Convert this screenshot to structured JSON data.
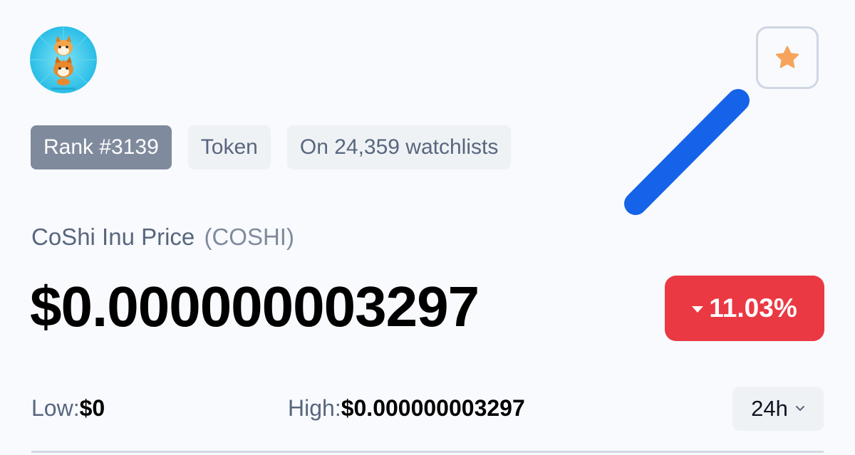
{
  "coin": {
    "logo_icon": "shiba-inu-logo-icon",
    "favorite_icon": "star-icon"
  },
  "tags": {
    "rank": "Rank #3139",
    "type": "Token",
    "watchlists": "On 24,359 watchlists"
  },
  "price": {
    "title": "CoShi Inu Price",
    "symbol": "(COSHI)",
    "value": "$0.000000003297",
    "change": "11.03%",
    "change_direction": "down",
    "change_icon": "caret-down-icon"
  },
  "range": {
    "low_label": "Low:",
    "low_value": "$0",
    "high_label": "High:",
    "high_value": "$0.000000003297",
    "period": "24h",
    "period_icon": "chevron-down-icon"
  },
  "colors": {
    "accent_star": "#f6a35c",
    "negative": "#ea3943",
    "annotation": "#1563e8",
    "rank_badge": "#808a9d",
    "tag_background": "#eff2f5",
    "muted_text": "#58667e"
  }
}
